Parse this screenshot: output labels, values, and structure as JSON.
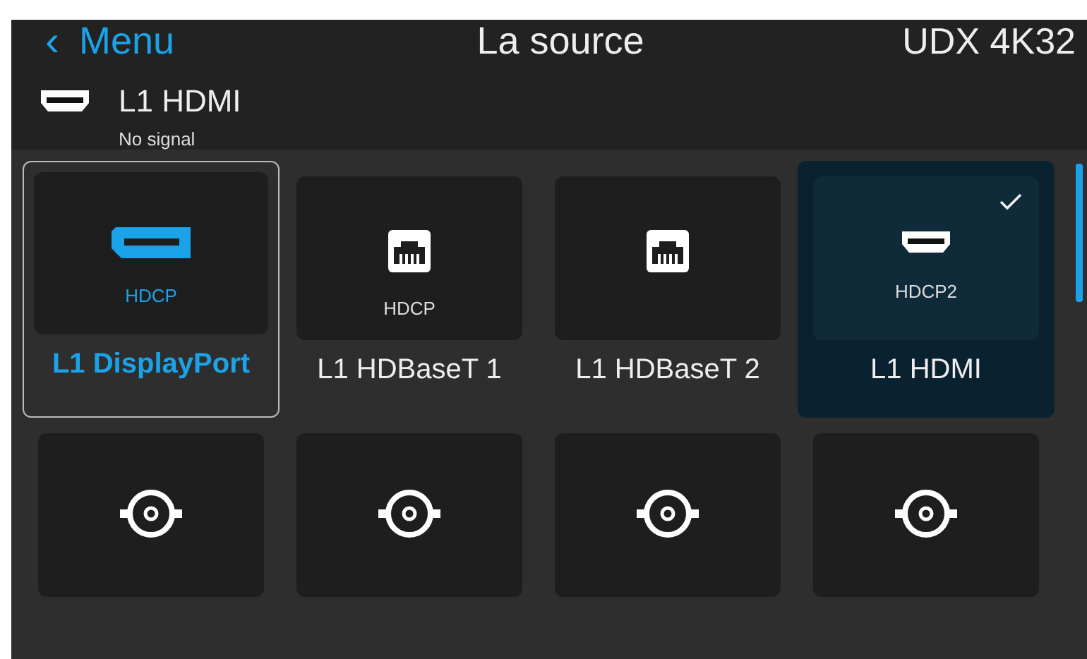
{
  "header": {
    "back": "‹",
    "back_label": "Menu",
    "title": "La source",
    "device": "UDX 4K32"
  },
  "current": {
    "kind": "hdmi",
    "name": "L1 HDMI",
    "status": "No signal"
  },
  "sources": [
    {
      "kind": "displayport",
      "protection": "HDCP",
      "label": "L1 DisplayPort",
      "focused": true,
      "selected": false
    },
    {
      "kind": "hdbaset",
      "protection": "HDCP",
      "label": "L1 HDBaseT 1",
      "focused": false,
      "selected": false
    },
    {
      "kind": "hdbaset",
      "label": "L1 HDBaseT 2",
      "focused": false,
      "selected": false
    },
    {
      "kind": "hdmi",
      "protection": "HDCP2",
      "label": "L1 HDMI",
      "focused": false,
      "selected": true
    },
    {
      "kind": "bnc",
      "focused": false,
      "selected": false
    },
    {
      "kind": "bnc",
      "focused": false,
      "selected": false
    },
    {
      "kind": "bnc",
      "focused": false,
      "selected": false
    },
    {
      "kind": "bnc",
      "focused": false,
      "selected": false
    }
  ]
}
